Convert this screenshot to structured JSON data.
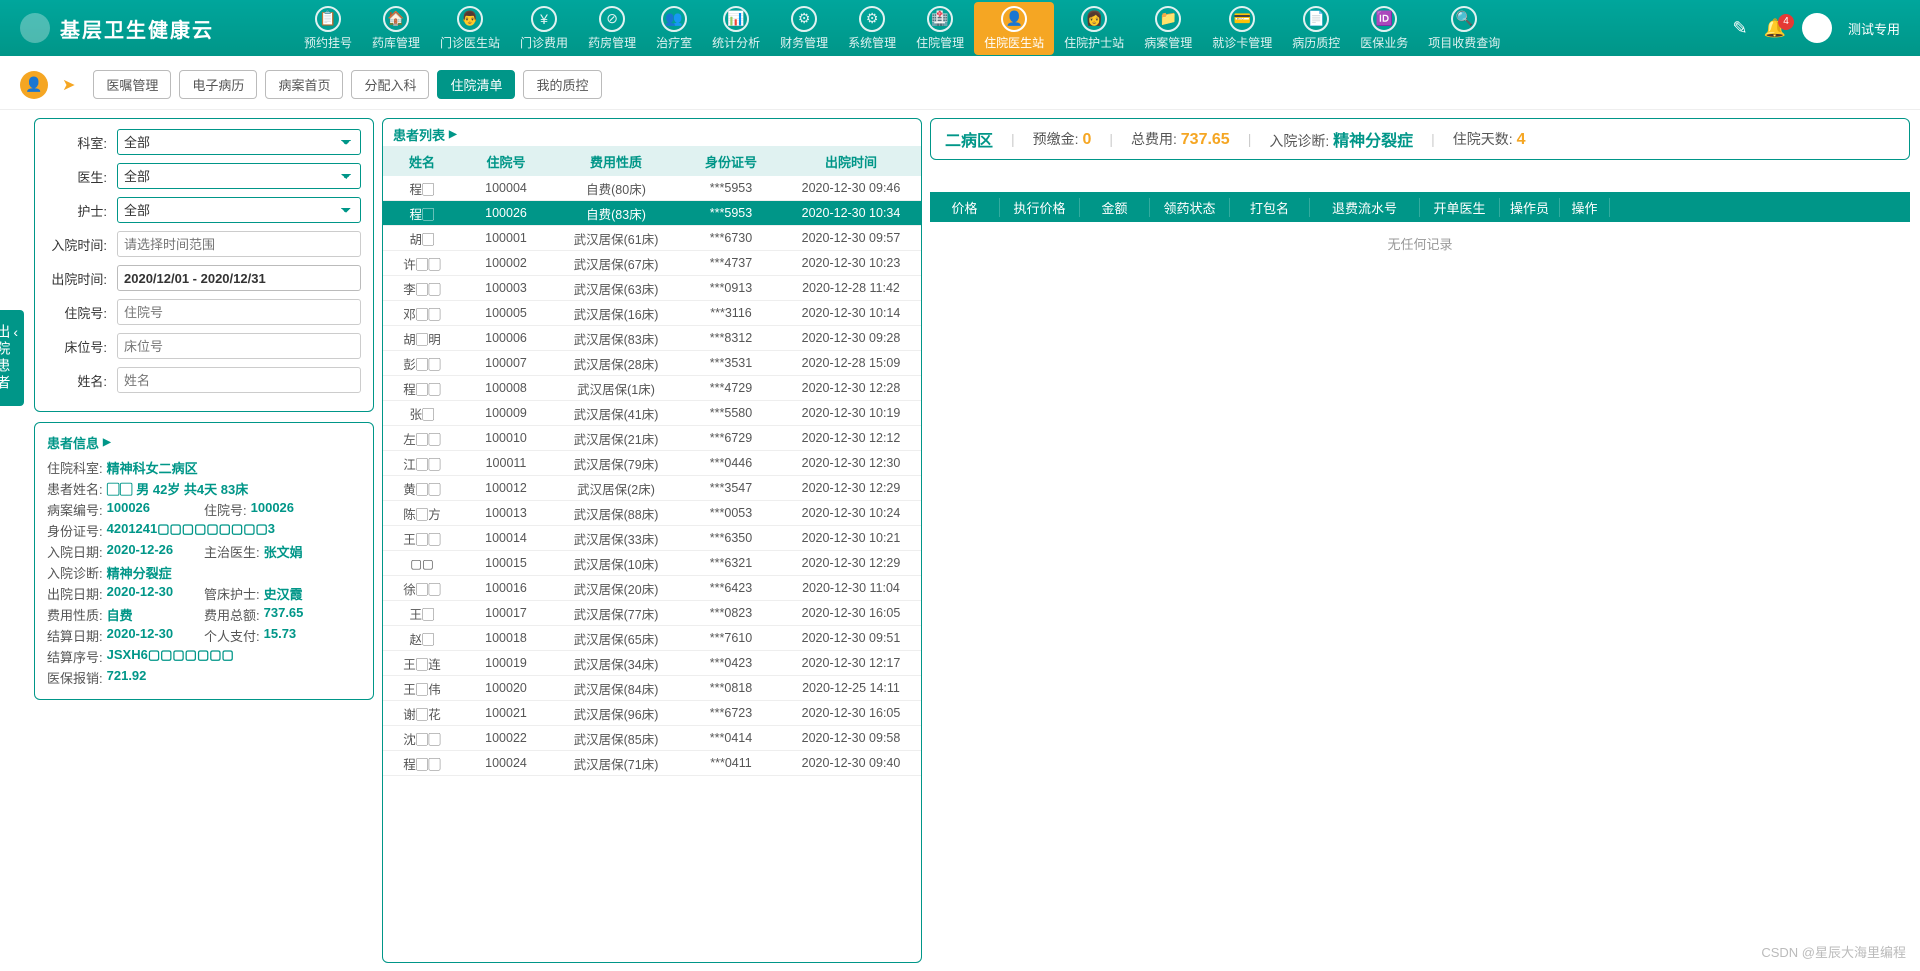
{
  "header": {
    "title": "基层卫生健康云",
    "nav": [
      {
        "label": "预约挂号",
        "icon": "📋"
      },
      {
        "label": "药库管理",
        "icon": "🏠"
      },
      {
        "label": "门诊医生站",
        "icon": "👨"
      },
      {
        "label": "门诊费用",
        "icon": "¥"
      },
      {
        "label": "药房管理",
        "icon": "⊘"
      },
      {
        "label": "治疗室",
        "icon": "👥"
      },
      {
        "label": "统计分析",
        "icon": "📊"
      },
      {
        "label": "财务管理",
        "icon": "⚙"
      },
      {
        "label": "系统管理",
        "icon": "⚙"
      },
      {
        "label": "住院管理",
        "icon": "🏥"
      },
      {
        "label": "住院医生站",
        "icon": "👤",
        "active": true
      },
      {
        "label": "住院护士站",
        "icon": "👩"
      },
      {
        "label": "病案管理",
        "icon": "📁"
      },
      {
        "label": "就诊卡管理",
        "icon": "💳"
      },
      {
        "label": "病历质控",
        "icon": "📄"
      },
      {
        "label": "医保业务",
        "icon": "🆔"
      },
      {
        "label": "项目收费查询",
        "icon": "🔍"
      }
    ],
    "badge": "4",
    "username": "测试专用"
  },
  "tabs": [
    "医嘱管理",
    "电子病历",
    "病案首页",
    "分配入科",
    "住院清单",
    "我的质控"
  ],
  "active_tab": 4,
  "side_tab": "出院患者",
  "filters": {
    "labels": {
      "dept": "科室:",
      "doctor": "医生:",
      "nurse": "护士:",
      "admit": "入院时间:",
      "discharge": "出院时间:",
      "hosp_no": "住院号:",
      "bed_no": "床位号:",
      "name": "姓名:"
    },
    "dept": "全部",
    "doctor": "全部",
    "nurse": "全部",
    "admit_placeholder": "请选择时间范围",
    "discharge_value": "2020/12/01 - 2020/12/31",
    "hosp_placeholder": "住院号",
    "bed_placeholder": "床位号",
    "name_placeholder": "姓名"
  },
  "patient_info": {
    "title": "患者信息",
    "rows": [
      {
        "l1": "住院科室:",
        "v1": "精神科女二病区"
      },
      {
        "l1": "患者姓名:",
        "v1": "▢▢ 男 42岁 共4天 83床"
      },
      {
        "l1": "病案编号:",
        "v1": "100026",
        "l2": "住院号:",
        "v2": "100026"
      },
      {
        "l1": "身份证号:",
        "v1": "4201241▢▢▢▢▢▢▢▢▢3"
      },
      {
        "l1": "入院日期:",
        "v1": "2020-12-26",
        "l2": "主治医生:",
        "v2": "张文娟"
      },
      {
        "l1": "入院诊断:",
        "v1": "精神分裂症"
      },
      {
        "l1": "出院日期:",
        "v1": "2020-12-30",
        "l2": "管床护士:",
        "v2": "史汉霞"
      },
      {
        "l1": "费用性质:",
        "v1": "自费",
        "l2": "费用总额:",
        "v2": "737.65"
      },
      {
        "l1": "结算日期:",
        "v1": "2020-12-30",
        "l2": "个人支付:",
        "v2": "15.73"
      },
      {
        "l1": "结算序号:",
        "v1": "JSXH6▢▢▢▢▢▢▢"
      },
      {
        "l1": "医保报销:",
        "v1": "721.92"
      }
    ]
  },
  "patient_list": {
    "title": "患者列表",
    "columns": [
      "姓名",
      "住院号",
      "费用性质",
      "身份证号",
      "出院时间"
    ],
    "selected": 1,
    "rows": [
      {
        "name": "程▢",
        "no": "100004",
        "pay": "自费(80床)",
        "id": "***5953",
        "time": "2020-12-30 09:46"
      },
      {
        "name": "程▢",
        "no": "100026",
        "pay": "自费(83床)",
        "id": "***5953",
        "time": "2020-12-30 10:34"
      },
      {
        "name": "胡▢",
        "no": "100001",
        "pay": "武汉居保(61床)",
        "id": "***6730",
        "time": "2020-12-30 09:57"
      },
      {
        "name": "许▢▢",
        "no": "100002",
        "pay": "武汉居保(67床)",
        "id": "***4737",
        "time": "2020-12-30 10:23"
      },
      {
        "name": "李▢▢",
        "no": "100003",
        "pay": "武汉居保(63床)",
        "id": "***0913",
        "time": "2020-12-28 11:42"
      },
      {
        "name": "邓▢▢",
        "no": "100005",
        "pay": "武汉居保(16床)",
        "id": "***3116",
        "time": "2020-12-30 10:14"
      },
      {
        "name": "胡▢明",
        "no": "100006",
        "pay": "武汉居保(83床)",
        "id": "***8312",
        "time": "2020-12-30 09:28"
      },
      {
        "name": "彭▢▢",
        "no": "100007",
        "pay": "武汉居保(28床)",
        "id": "***3531",
        "time": "2020-12-28 15:09"
      },
      {
        "name": "程▢▢",
        "no": "100008",
        "pay": "武汉居保(1床)",
        "id": "***4729",
        "time": "2020-12-30 12:28"
      },
      {
        "name": "张▢",
        "no": "100009",
        "pay": "武汉居保(41床)",
        "id": "***5580",
        "time": "2020-12-30 10:19"
      },
      {
        "name": "左▢▢",
        "no": "100010",
        "pay": "武汉居保(21床)",
        "id": "***6729",
        "time": "2020-12-30 12:12"
      },
      {
        "name": "江▢▢",
        "no": "100011",
        "pay": "武汉居保(79床)",
        "id": "***0446",
        "time": "2020-12-30 12:30"
      },
      {
        "name": "黄▢▢",
        "no": "100012",
        "pay": "武汉居保(2床)",
        "id": "***3547",
        "time": "2020-12-30 12:29"
      },
      {
        "name": "陈▢方",
        "no": "100013",
        "pay": "武汉居保(88床)",
        "id": "***0053",
        "time": "2020-12-30 10:24"
      },
      {
        "name": "王▢▢",
        "no": "100014",
        "pay": "武汉居保(33床)",
        "id": "***6350",
        "time": "2020-12-30 10:21"
      },
      {
        "name": "▢▢",
        "no": "100015",
        "pay": "武汉居保(10床)",
        "id": "***6321",
        "time": "2020-12-30 12:29"
      },
      {
        "name": "徐▢▢",
        "no": "100016",
        "pay": "武汉居保(20床)",
        "id": "***6423",
        "time": "2020-12-30 11:04"
      },
      {
        "name": "王▢",
        "no": "100017",
        "pay": "武汉居保(77床)",
        "id": "***0823",
        "time": "2020-12-30 16:05"
      },
      {
        "name": "赵▢",
        "no": "100018",
        "pay": "武汉居保(65床)",
        "id": "***7610",
        "time": "2020-12-30 09:51"
      },
      {
        "name": "王▢连",
        "no": "100019",
        "pay": "武汉居保(34床)",
        "id": "***0423",
        "time": "2020-12-30 12:17"
      },
      {
        "name": "王▢伟",
        "no": "100020",
        "pay": "武汉居保(84床)",
        "id": "***0818",
        "time": "2020-12-25 14:11"
      },
      {
        "name": "谢▢花",
        "no": "100021",
        "pay": "武汉居保(96床)",
        "id": "***6723",
        "time": "2020-12-30 16:05"
      },
      {
        "name": "沈▢▢",
        "no": "100022",
        "pay": "武汉居保(85床)",
        "id": "***0414",
        "time": "2020-12-30 09:58"
      },
      {
        "name": "程▢▢",
        "no": "100024",
        "pay": "武汉居保(71床)",
        "id": "***0411",
        "time": "2020-12-30 09:40"
      }
    ]
  },
  "summary": {
    "ward_label": "二病区",
    "deposit_label": "预缴金:",
    "deposit": "0",
    "total_label": "总费用:",
    "total": "737.65",
    "diag_label": "入院诊断:",
    "diag": "精神分裂症",
    "days_label": "住院天数:",
    "days": "4"
  },
  "detail_columns": [
    "价格",
    "执行价格",
    "金额",
    "领药状态",
    "打包名",
    "退费流水号",
    "开单医生",
    "操作员",
    "操作"
  ],
  "detail_empty": "无任何记录",
  "watermark": "CSDN @星辰大海里编程"
}
